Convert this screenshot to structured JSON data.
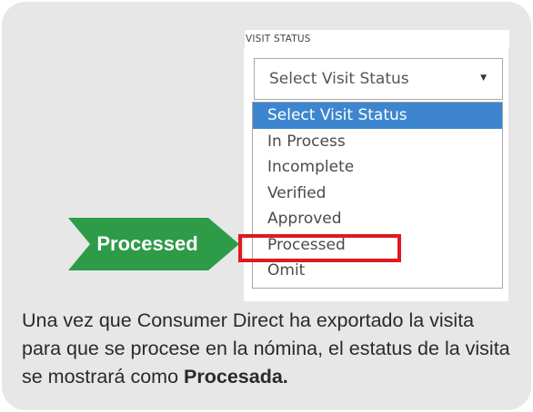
{
  "field": {
    "label": "VISIT STATUS",
    "selected_value": "Select Visit Status",
    "caret_icon": "caret-down-icon"
  },
  "dropdown": {
    "options": [
      "Select Visit Status",
      "In Process",
      "Incomplete",
      "Verified",
      "Approved",
      "Processed",
      "Omit"
    ],
    "highlighted_option": "Select Visit Status",
    "boxed_option": "Processed"
  },
  "callout": {
    "label": "Processed",
    "color": "#2e9b48"
  },
  "caption": {
    "text": "Una vez que Consumer Direct ha exportado la visita para que se procese en la nómina, el estatus de la visita se mostrará como ",
    "emphasis": "Procesada."
  },
  "colors": {
    "card_background": "#e7e7e7",
    "selected_option": "#3d86cf",
    "highlight_border": "#e0191f"
  }
}
